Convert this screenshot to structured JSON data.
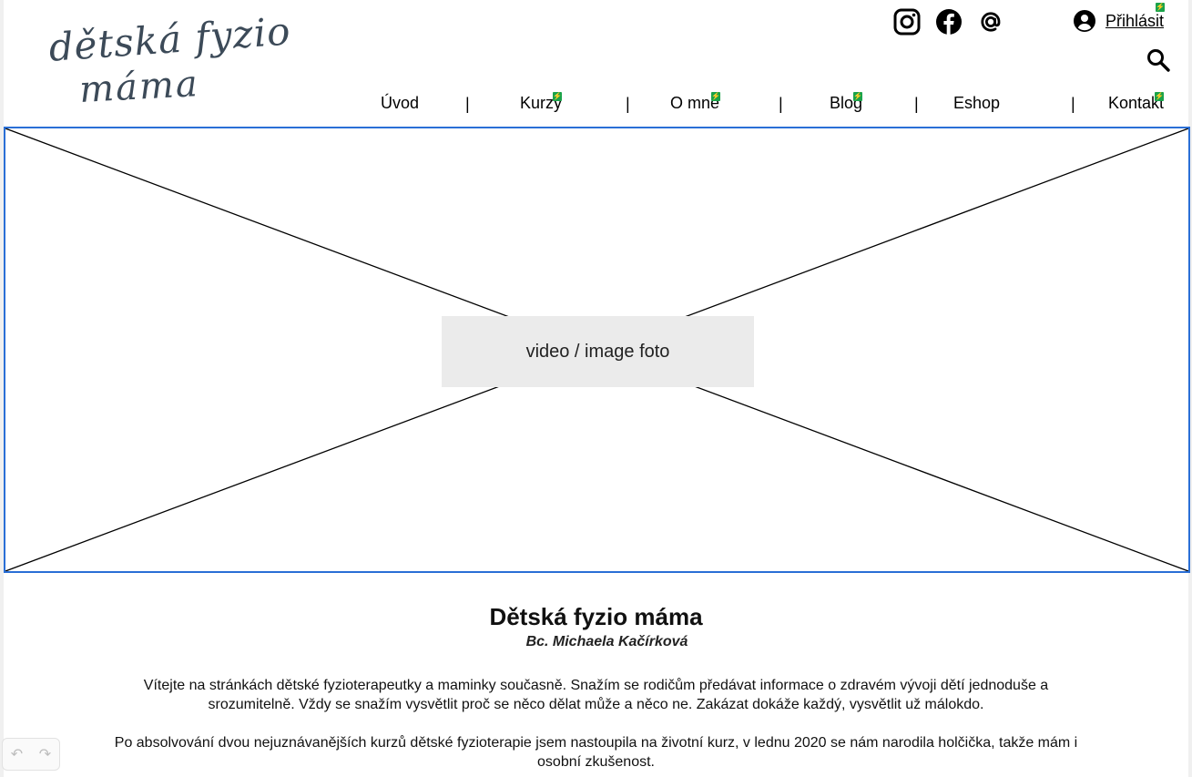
{
  "logo": {
    "line1": "dětská fyzio",
    "line2": "máma"
  },
  "social": [
    {
      "name": "instagram-icon"
    },
    {
      "name": "facebook-icon"
    },
    {
      "name": "at-icon"
    }
  ],
  "login": {
    "label": "Přihlásit"
  },
  "nav": {
    "items": [
      {
        "label": "Úvod",
        "badge": false
      },
      {
        "label": "Kurzy",
        "badge": true
      },
      {
        "label": "O mne",
        "badge": true
      },
      {
        "label": "Blog",
        "badge": true
      },
      {
        "label": "Eshop",
        "badge": false
      },
      {
        "label": "Kontakt",
        "badge": true
      }
    ],
    "separator": "|"
  },
  "hero": {
    "placeholder": "video / image foto"
  },
  "content": {
    "title": "Dětská fyzio máma",
    "subtitle": "Bc. Michaela Kačírková",
    "paragraph1": "Vítejte na stránkách dětské fyzioterapeutky a maminky současně. Snažím se rodičům předávat informace o zdravém vývoji dětí jednoduše a srozumitelně. Vždy se snažím vysvětlit proč se něco dělat může a něco ne. Zakázat dokáže každý, vysvětlit už málokdo.",
    "paragraph2": "Po absolvování dvou nejuznávanějších kurzů dětské fyzioterapie jsem nastoupila na životní kurz, v lednu 2020 se nám narodila holčička, takže mám i osobní zkušenost."
  },
  "colors": {
    "accent": "#2a6fd6",
    "badge": "#1aa34a",
    "logo": "#3c4a58"
  }
}
